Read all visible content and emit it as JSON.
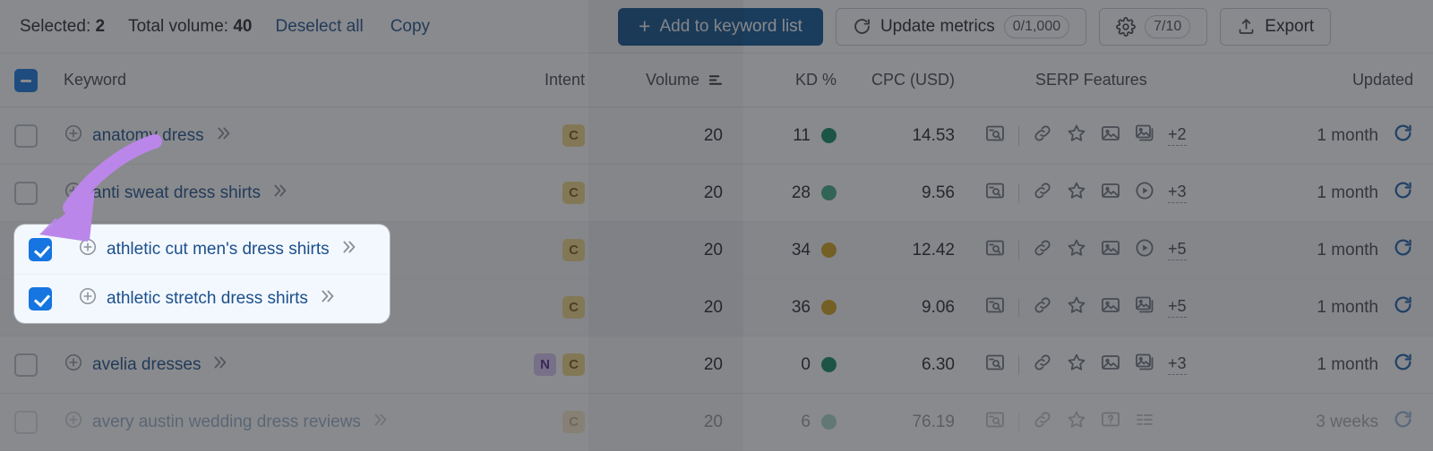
{
  "toolbar": {
    "selected_label": "Selected:",
    "selected_count": "2",
    "total_volume_label": "Total volume:",
    "total_volume_value": "40",
    "deselect_all": "Deselect all",
    "copy": "Copy",
    "add_to_keyword_list": "Add to keyword list",
    "add_plus": "+",
    "update_metrics": "Update metrics",
    "update_metrics_quota": "0/1,000",
    "settings_quota": "7/10",
    "export": "Export"
  },
  "table": {
    "headers": {
      "keyword": "Keyword",
      "intent": "Intent",
      "volume": "Volume",
      "kd": "KD %",
      "cpc": "CPC (USD)",
      "serp_features": "SERP Features",
      "updated": "Updated"
    },
    "rows": [
      {
        "keyword": "anatomy dress",
        "checked": false,
        "intent": [
          "C"
        ],
        "volume": "20",
        "kd": "11",
        "kd_color": "#0e8a63",
        "cpc": "14.53",
        "serp": [
          "search-preview-icon",
          "link-icon",
          "star-icon",
          "image-icon",
          "image-pack-icon"
        ],
        "serp_more": "+2",
        "updated": "1 month"
      },
      {
        "keyword": "anti sweat dress shirts",
        "checked": false,
        "intent": [
          "C"
        ],
        "volume": "20",
        "kd": "28",
        "kd_color": "#3dab82",
        "cpc": "9.56",
        "serp": [
          "search-preview-icon",
          "link-icon",
          "star-icon",
          "image-icon",
          "video-icon"
        ],
        "serp_more": "+3",
        "updated": "1 month"
      },
      {
        "keyword": "athletic cut men's dress shirts",
        "checked": true,
        "intent": [
          "C"
        ],
        "volume": "20",
        "kd": "34",
        "kd_color": "#d1a01a",
        "cpc": "12.42",
        "serp": [
          "search-preview-icon",
          "link-icon",
          "star-icon",
          "image-icon",
          "video-icon"
        ],
        "serp_more": "+5",
        "updated": "1 month"
      },
      {
        "keyword": "athletic stretch dress shirts",
        "checked": true,
        "intent": [
          "C"
        ],
        "volume": "20",
        "kd": "36",
        "kd_color": "#d1a01a",
        "cpc": "9.06",
        "serp": [
          "search-preview-icon",
          "link-icon",
          "star-icon",
          "image-icon",
          "image-pack-icon"
        ],
        "serp_more": "+5",
        "updated": "1 month"
      },
      {
        "keyword": "avelia dresses",
        "checked": false,
        "intent": [
          "N",
          "C"
        ],
        "volume": "20",
        "kd": "0",
        "kd_color": "#0e8a63",
        "cpc": "6.30",
        "serp": [
          "search-preview-icon",
          "link-icon",
          "star-icon",
          "image-icon",
          "image-pack-icon"
        ],
        "serp_more": "+3",
        "updated": "1 month"
      },
      {
        "keyword": "avery austin wedding dress reviews",
        "checked": false,
        "intent": [
          "C"
        ],
        "volume": "20",
        "kd": "6",
        "kd_color": "#3dab82",
        "cpc": "76.19",
        "serp": [
          "search-preview-icon",
          "link-icon",
          "star-icon",
          "faq-icon",
          "list-icon"
        ],
        "serp_more": "",
        "updated": "3 weeks"
      }
    ]
  },
  "spotlight": {
    "rows": [
      {
        "keyword": "athletic cut men's dress shirts",
        "checked": true
      },
      {
        "keyword": "athletic stretch dress shirts",
        "checked": true
      }
    ]
  },
  "annotation": {
    "arrow_color": "#bb86ea",
    "kind": "curved-arrow-pointing-down-left"
  },
  "colors": {
    "primary_button": "#0b5394",
    "link": "#1b4f8c",
    "checkbox_accent": "#1675e0",
    "intent_commercial_bg": "#f2d785",
    "intent_navigational_bg": "#d9c4f5"
  }
}
